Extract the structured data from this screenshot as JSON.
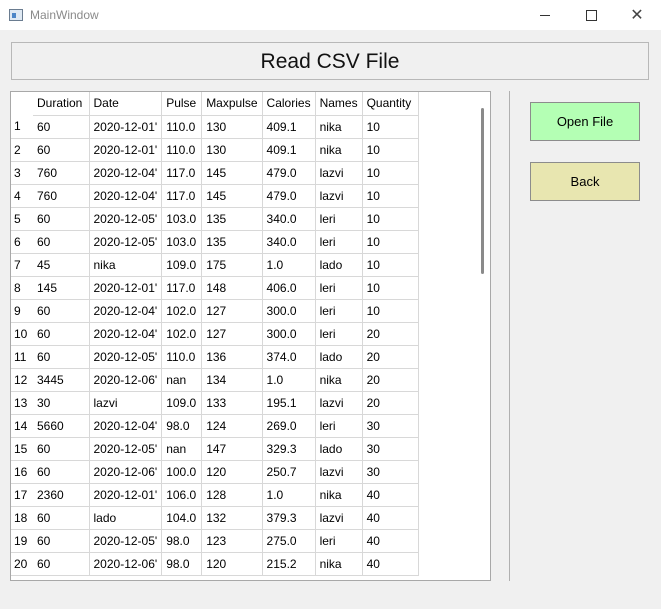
{
  "window": {
    "title": "MainWindow",
    "minimize_glyph": "",
    "close_glyph": "✕"
  },
  "header": {
    "title": "Read CSV File"
  },
  "buttons": {
    "open_file": "Open File",
    "back": "Back"
  },
  "table": {
    "columns": [
      "Duration",
      "Date",
      "Pulse",
      "Maxpulse",
      "Calories",
      "Names",
      "Quantity"
    ],
    "rows": [
      [
        "1",
        "60",
        "2020-12-01'",
        "110.0",
        "130",
        "409.1",
        "nika",
        "10"
      ],
      [
        "2",
        "60",
        "2020-12-01'",
        "110.0",
        "130",
        "409.1",
        "nika",
        "10"
      ],
      [
        "3",
        "760",
        "2020-12-04'",
        "117.0",
        "145",
        "479.0",
        "lazvi",
        "10"
      ],
      [
        "4",
        "760",
        "2020-12-04'",
        "117.0",
        "145",
        "479.0",
        "lazvi",
        "10"
      ],
      [
        "5",
        "60",
        "2020-12-05'",
        "103.0",
        "135",
        "340.0",
        "leri",
        "10"
      ],
      [
        "6",
        "60",
        "2020-12-05'",
        "103.0",
        "135",
        "340.0",
        "leri",
        "10"
      ],
      [
        "7",
        "45",
        "nika",
        "109.0",
        "175",
        "1.0",
        "lado",
        "10"
      ],
      [
        "8",
        "145",
        "2020-12-01'",
        "117.0",
        "148",
        "406.0",
        "leri",
        "10"
      ],
      [
        "9",
        "60",
        "2020-12-04'",
        "102.0",
        "127",
        "300.0",
        "leri",
        "10"
      ],
      [
        "10",
        "60",
        "2020-12-04'",
        "102.0",
        "127",
        "300.0",
        "leri",
        "20"
      ],
      [
        "11",
        "60",
        "2020-12-05'",
        "110.0",
        "136",
        "374.0",
        "lado",
        "20"
      ],
      [
        "12",
        "3445",
        "2020-12-06'",
        "nan",
        "134",
        "1.0",
        "nika",
        "20"
      ],
      [
        "13",
        "30",
        "lazvi",
        "109.0",
        "133",
        "195.1",
        "lazvi",
        "20"
      ],
      [
        "14",
        "5660",
        "2020-12-04'",
        "98.0",
        "124",
        "269.0",
        "leri",
        "30"
      ],
      [
        "15",
        "60",
        "2020-12-05'",
        "nan",
        "147",
        "329.3",
        "lado",
        "30"
      ],
      [
        "16",
        "60",
        "2020-12-06'",
        "100.0",
        "120",
        "250.7",
        "lazvi",
        "30"
      ],
      [
        "17",
        "2360",
        "2020-12-01'",
        "106.0",
        "128",
        "1.0",
        "nika",
        "40"
      ],
      [
        "18",
        "60",
        "lado",
        "104.0",
        "132",
        "379.3",
        "lazvi",
        "40"
      ],
      [
        "19",
        "60",
        "2020-12-05'",
        "98.0",
        "123",
        "275.0",
        "leri",
        "40"
      ],
      [
        "20",
        "60",
        "2020-12-06'",
        "98.0",
        "120",
        "215.2",
        "nika",
        "40"
      ]
    ]
  }
}
